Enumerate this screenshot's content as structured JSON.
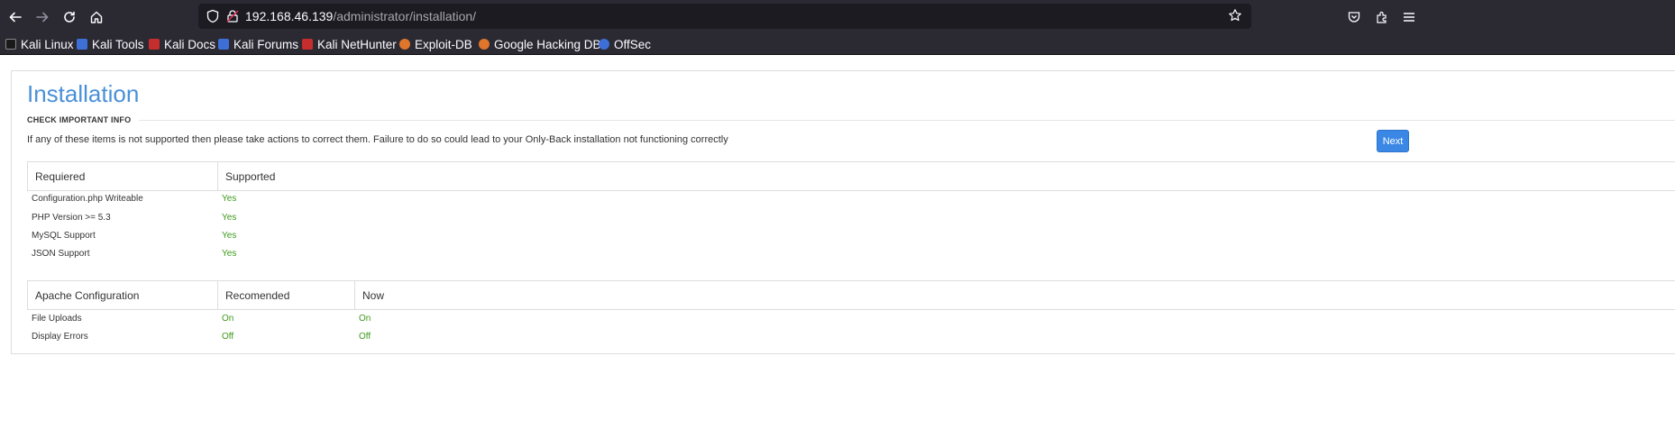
{
  "browser": {
    "url_host": "192.168.46.139",
    "url_path": "/administrator/installation/",
    "bookmarks": [
      {
        "label": "Kali Linux",
        "color": "#2a2a2a"
      },
      {
        "label": "Kali Tools",
        "color": "#3d6fd6"
      },
      {
        "label": "Kali Docs",
        "color": "#c62d2d"
      },
      {
        "label": "Kali Forums",
        "color": "#3d6fd6"
      },
      {
        "label": "Kali NetHunter",
        "color": "#c62d2d"
      },
      {
        "label": "Exploit-DB",
        "color": "#e0752c"
      },
      {
        "label": "Google Hacking DB",
        "color": "#e0752c"
      },
      {
        "label": "OffSec",
        "color": "#3d6fd6"
      }
    ]
  },
  "page": {
    "title": "Installation",
    "section_label": "CHECK IMPORTANT INFO",
    "intro": "If any of these items is not supported then please take actions to correct them. Failure to do so could lead to your Only-Back installation not functioning correctly",
    "next_label": "Next",
    "accent_color": "#4a90d9"
  },
  "requirements": {
    "headers": [
      "Requiered",
      "Supported"
    ],
    "rows": [
      {
        "label": "Configuration.php Writeable",
        "value": "Yes"
      },
      {
        "label": "PHP Version >= 5.3",
        "value": "Yes"
      },
      {
        "label": "MySQL Support",
        "value": "Yes"
      },
      {
        "label": "JSON Support",
        "value": "Yes"
      }
    ]
  },
  "apache": {
    "headers": [
      "Apache Configuration",
      "Recomended",
      "Now"
    ],
    "rows": [
      {
        "label": "File Uploads",
        "recommended": "On",
        "now": "On"
      },
      {
        "label": "Display Errors",
        "recommended": "Off",
        "now": "Off"
      }
    ]
  }
}
